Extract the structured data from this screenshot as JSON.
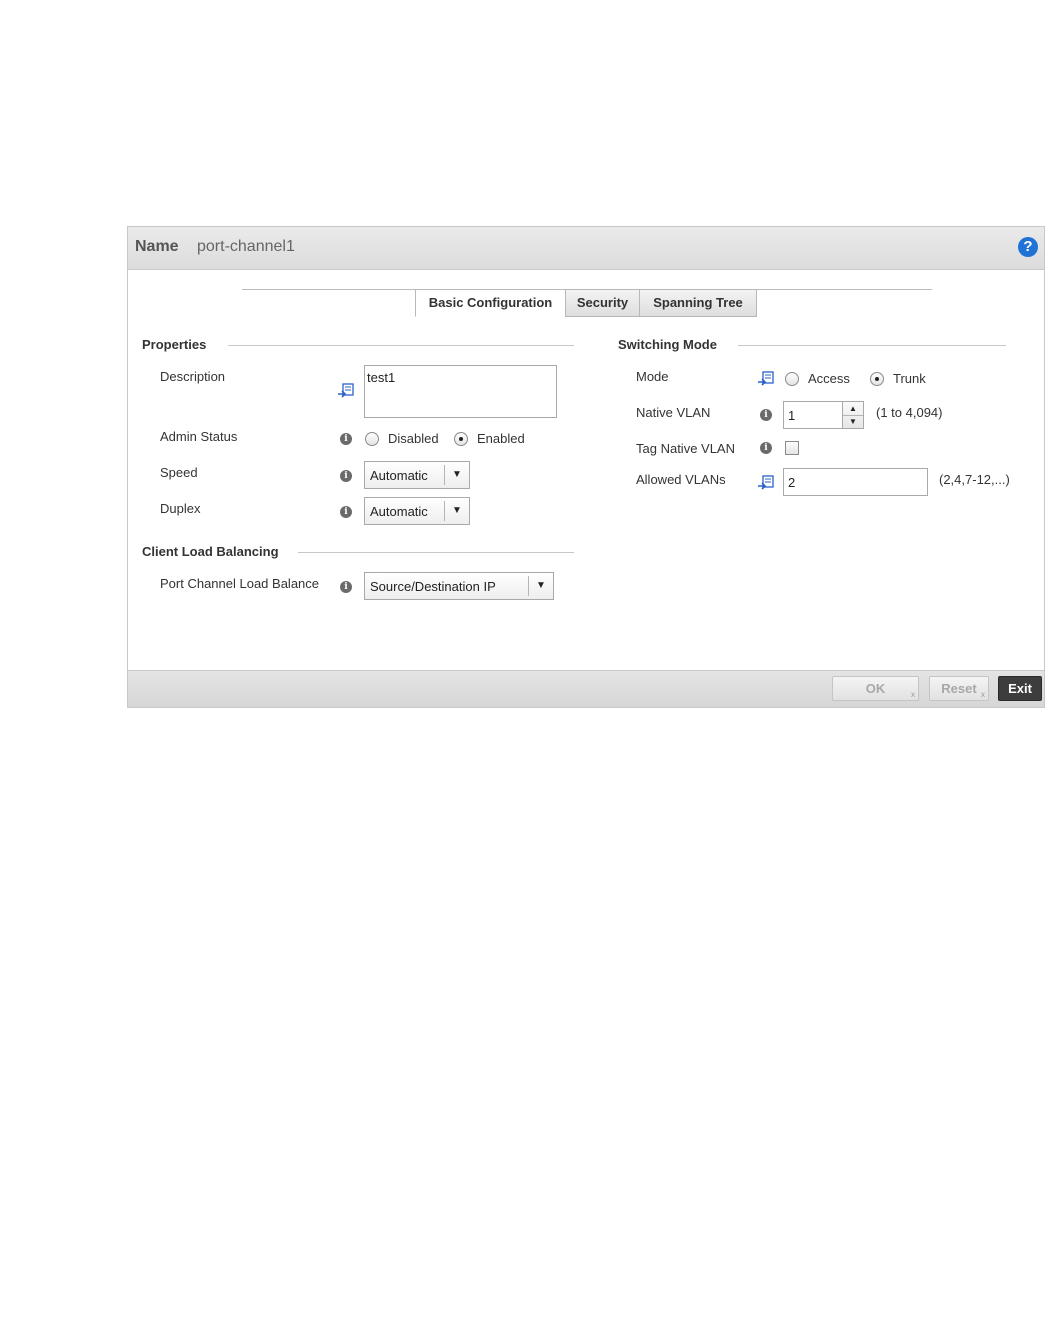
{
  "header": {
    "name_label": "Name",
    "name_value": "port-channel1",
    "help_icon": "?"
  },
  "tabs": [
    {
      "label": "Basic Configuration",
      "active": true
    },
    {
      "label": "Security",
      "active": false
    },
    {
      "label": "Spanning Tree",
      "active": false
    }
  ],
  "properties": {
    "title": "Properties",
    "description": {
      "label": "Description",
      "value": "test1"
    },
    "admin_status": {
      "label": "Admin Status",
      "options": [
        "Disabled",
        "Enabled"
      ],
      "selected": "Enabled"
    },
    "speed": {
      "label": "Speed",
      "value": "Automatic"
    },
    "duplex": {
      "label": "Duplex",
      "value": "Automatic"
    }
  },
  "client_load_balancing": {
    "title": "Client Load Balancing",
    "port_channel_load_balance": {
      "label": "Port Channel Load Balance",
      "value": "Source/Destination IP"
    }
  },
  "switching_mode": {
    "title": "Switching Mode",
    "mode": {
      "label": "Mode",
      "options": [
        "Access",
        "Trunk"
      ],
      "selected": "Trunk"
    },
    "native_vlan": {
      "label": "Native VLAN",
      "value": "1",
      "hint": "(1 to 4,094)"
    },
    "tag_native_vlan": {
      "label": "Tag Native VLAN",
      "checked": false
    },
    "allowed_vlans": {
      "label": "Allowed VLANs",
      "value": "2",
      "hint": "(2,4,7-12,...)"
    }
  },
  "footer": {
    "ok_label": "OK",
    "reset_label": "Reset",
    "exit_label": "Exit",
    "button_sub": "x"
  },
  "icons": {
    "info": "i",
    "arrow": "▼",
    "spin_up": "▲",
    "spin_down": "▼"
  },
  "colors": {
    "help_blue": "#1f72d6",
    "override_blue": "#2a62c9",
    "exit_bg": "#3d3d3d"
  }
}
